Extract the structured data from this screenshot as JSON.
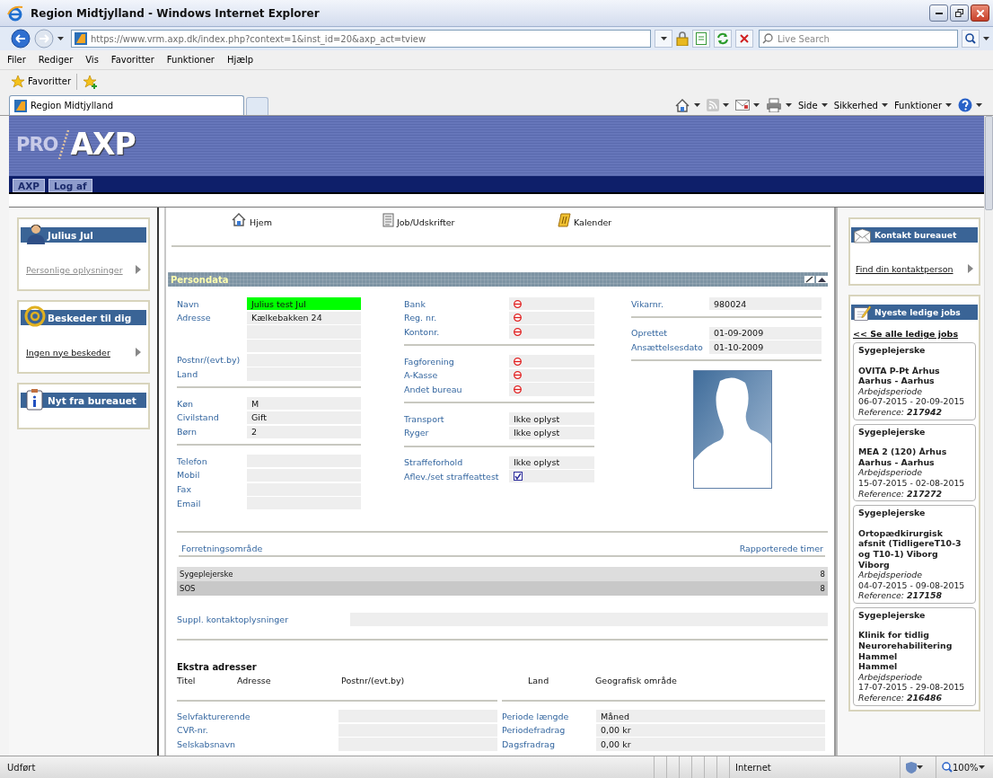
{
  "window": {
    "title": "Region Midtjylland - Windows Internet Explorer"
  },
  "address_bar": {
    "url": "https://www.vrm.axp.dk/index.php?context=1&inst_id=20&axp_act=tview"
  },
  "search": {
    "placeholder": "Live Search"
  },
  "menu": [
    "Filer",
    "Rediger",
    "Vis",
    "Favoritter",
    "Funktioner",
    "Hjælp"
  ],
  "favorites_bar": {
    "label": "Favoritter"
  },
  "tabs": [
    {
      "label": "Region Midtjylland",
      "selected": true
    }
  ],
  "command_bar": [
    "Side",
    "Sikkerhed",
    "Funktioner"
  ],
  "page": {
    "logo": {
      "prefix": "PRO",
      "name": "AXP"
    },
    "nav_buttons": [
      "AXP",
      "Log af"
    ],
    "left_sidebar": [
      {
        "kind": "person",
        "title": "Julius Jul",
        "link": {
          "label": "Personlige oplysninger",
          "visited": true
        }
      },
      {
        "kind": "messages",
        "title": "Beskeder til dig",
        "link": {
          "label": "Ingen nye beskeder",
          "visited": false
        }
      },
      {
        "kind": "info",
        "title": "Nyt fra bureauet"
      }
    ],
    "top_nav": [
      {
        "kind": "home",
        "label": "Hjem"
      },
      {
        "kind": "document",
        "label": "Job/Udskrifter"
      },
      {
        "kind": "calendar",
        "label": "Kalender"
      }
    ],
    "panel": {
      "title": "Persondata",
      "columns": [
        {
          "groups": [
            {
              "rows": [
                {
                  "label": "Navn",
                  "kind": "highlight",
                  "value": "Julius test Jul"
                },
                {
                  "label": "Adresse",
                  "kind": "text",
                  "value": "Kælkebakken 24"
                },
                {},
                {},
                {
                  "label": "Postnr/(evt.by)"
                },
                {
                  "label": "Land"
                }
              ]
            },
            {
              "rows": [
                {
                  "label": "Køn",
                  "kind": "text",
                  "value": "M"
                },
                {
                  "label": "Civilstand",
                  "kind": "text",
                  "value": "Gift"
                },
                {
                  "label": "Børn",
                  "kind": "text",
                  "value": "2"
                }
              ]
            },
            {
              "rows": [
                {
                  "label": "Telefon"
                },
                {
                  "label": "Mobil"
                },
                {
                  "label": "Fax"
                },
                {
                  "label": "Email"
                }
              ]
            }
          ]
        },
        {
          "groups": [
            {
              "rows": [
                {
                  "label": "Bank",
                  "kind": "blocked"
                },
                {
                  "label": "Reg. nr.",
                  "kind": "blocked"
                },
                {
                  "label": "Kontonr.",
                  "kind": "blocked"
                }
              ]
            },
            {
              "rows": [
                {
                  "label": "Fagforening",
                  "kind": "blocked"
                },
                {
                  "label": "A-Kasse",
                  "kind": "blocked"
                },
                {
                  "label": "Andet bureau",
                  "kind": "blocked"
                }
              ]
            },
            {
              "rows": [
                {
                  "label": "Transport",
                  "kind": "text",
                  "value": "Ikke oplyst"
                },
                {
                  "label": "Ryger",
                  "kind": "text",
                  "value": "Ikke oplyst"
                }
              ]
            },
            {
              "rows": [
                {
                  "label": "Straffeforhold",
                  "kind": "text",
                  "value": "Ikke oplyst"
                },
                {
                  "label": "Aflev./set straffeattest",
                  "kind": "checkbox",
                  "checked": true
                }
              ]
            }
          ]
        },
        {
          "groups": [
            {
              "rows": [
                {
                  "label": "Vikarnr.",
                  "kind": "text",
                  "value": "980024"
                }
              ]
            },
            {
              "rows": [
                {
                  "label": "Oprettet",
                  "kind": "text",
                  "value": "01-09-2009"
                },
                {
                  "label": "Ansættelsesdato",
                  "kind": "text",
                  "value": "01-10-2009"
                }
              ]
            }
          ],
          "photo": {
            "kind": "picture"
          }
        }
      ],
      "business_areas": {
        "columns": [
          "Forretningsområde",
          "Rapporterede timer"
        ],
        "rows": [
          {
            "name": "Sygeplejerske",
            "hours": "8"
          },
          {
            "name": "SOS",
            "hours": "8"
          }
        ]
      },
      "supplementary": {
        "label": "Suppl. kontaktoplysninger"
      },
      "extra_addresses": {
        "title": "Ekstra adresser",
        "columns": [
          "Titel",
          "Adresse",
          "Postnr/(evt.by)",
          "Land",
          "Geografisk område"
        ]
      },
      "billing": {
        "left": [
          {
            "label": "Selvfakturerende"
          },
          {
            "label": "CVR-nr."
          },
          {
            "label": "Selskabsnavn"
          }
        ],
        "right": [
          {
            "label": "Periode længde",
            "kind": "text",
            "value": "Måned"
          },
          {
            "label": "Periodefradrag",
            "kind": "text",
            "value": "0,00 kr"
          },
          {
            "label": "Dagsfradrag",
            "kind": "text",
            "value": "0,00 kr"
          }
        ]
      }
    },
    "right_sidebar": {
      "contact": {
        "title": "Kontakt bureauet",
        "link": "Find din kontaktperson"
      },
      "jobs": {
        "title": "Nyeste ledige jobs",
        "see_all": "<< Se alle ledige jobs",
        "items": [
          {
            "title": "Sygeplejerske",
            "place": "OVITA P-Pt Århus",
            "city": "Aarhus - Aarhus",
            "period_label": "Arbejdsperiode",
            "period": "06-07-2015 - 20-09-2015",
            "reference": "Reference: **217942**"
          },
          {
            "title": "Sygeplejerske",
            "place": "MEA 2 (120) Århus",
            "city": "Aarhus - Aarhus",
            "period_label": "Arbejdsperiode",
            "period": "15-07-2015 - 02-08-2015",
            "reference": "Reference: **217272**"
          },
          {
            "title": "Sygeplejerske",
            "place": "Ortopædkirurgisk afsnit (TidligereT10-3 og T10-1) Viborg",
            "city": "Viborg",
            "period_label": "Arbejdsperiode",
            "period": "04-07-2015 - 09-08-2015",
            "reference": "Reference: **217158**"
          },
          {
            "title": "Sygeplejerske",
            "place": "Klinik for tidlig Neurorehabilitering Hammel",
            "city": "Hammel",
            "period_label": "Arbejdsperiode",
            "period": "17-07-2015 - 29-08-2015",
            "reference": "Reference: **216486**"
          }
        ]
      }
    }
  },
  "status_bar": {
    "text": "Udført",
    "zone": "Internet",
    "zoom": "100%"
  }
}
